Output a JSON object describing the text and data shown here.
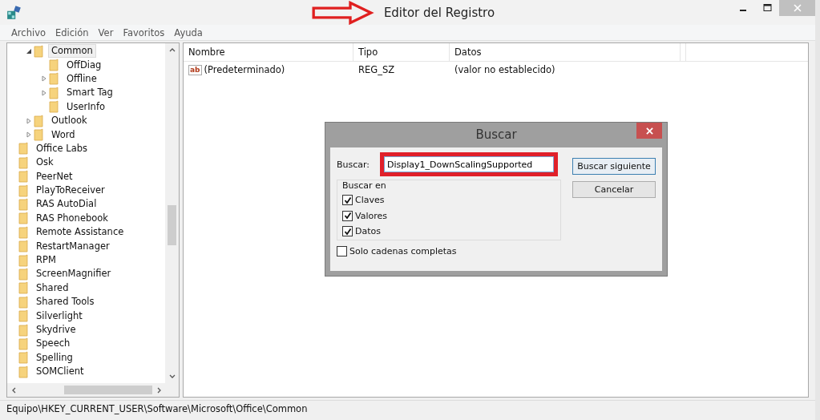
{
  "window": {
    "title": "Editor del Registro"
  },
  "menu": [
    "Archivo",
    "Edición",
    "Ver",
    "Favoritos",
    "Ayuda"
  ],
  "tree": {
    "items": [
      {
        "children": [
          {
            "label": "Common",
            "selected": true,
            "expanded": true,
            "children": [
              {
                "label": "OffDiag",
                "selected": false
              },
              {
                "label": "Offline",
                "selected": false,
                "expanded": false
              },
              {
                "label": "Smart Tag",
                "selected": false,
                "expanded": false
              },
              {
                "label": "UserInfo",
                "selected": false
              }
            ]
          },
          {
            "label": "Outlook",
            "selected": false,
            "expanded": false
          },
          {
            "label": "Word",
            "selected": false,
            "expanded": false
          }
        ]
      },
      {
        "label": "Office Labs",
        "selected": false
      },
      {
        "label": "Osk",
        "selected": false
      },
      {
        "label": "PeerNet",
        "selected": false
      },
      {
        "label": "PlayToReceiver",
        "selected": false
      },
      {
        "label": "RAS AutoDial",
        "selected": false
      },
      {
        "label": "RAS Phonebook",
        "selected": false
      },
      {
        "label": "Remote Assistance",
        "selected": false
      },
      {
        "label": "RestartManager",
        "selected": false
      },
      {
        "label": "RPM",
        "selected": false
      },
      {
        "label": "ScreenMagnifier",
        "selected": false
      },
      {
        "label": "Shared",
        "selected": false
      },
      {
        "label": "Shared Tools",
        "selected": false
      },
      {
        "label": "Silverlight",
        "selected": false
      },
      {
        "label": "Skydrive",
        "selected": false
      },
      {
        "label": "Speech",
        "selected": false
      },
      {
        "label": "Spelling",
        "selected": false
      },
      {
        "label": "SOMClient",
        "selected": false
      }
    ]
  },
  "table": {
    "columns": [
      "Nombre",
      "Tipo",
      "Datos"
    ],
    "rows": [
      {
        "icon_text": "ab",
        "name": "(Predeterminado)",
        "type": "REG_SZ",
        "data": "(valor no establecido)"
      }
    ]
  },
  "dialog": {
    "title": "Buscar",
    "search_label": "Buscar:",
    "search_value": "Display1_DownScalingSupported",
    "group_label": "Buscar en",
    "options": [
      {
        "label": "Claves",
        "checked": true
      },
      {
        "label": "Valores",
        "checked": true
      },
      {
        "label": "Datos",
        "checked": true
      }
    ],
    "whole_match": {
      "label": "Solo cadenas completas",
      "checked": false
    },
    "buttons": [
      "Buscar siguiente",
      "Cancelar"
    ]
  },
  "status_bar": "Equipo\\HKEY_CURRENT_USER\\Software\\Microsoft\\Office\\Common"
}
